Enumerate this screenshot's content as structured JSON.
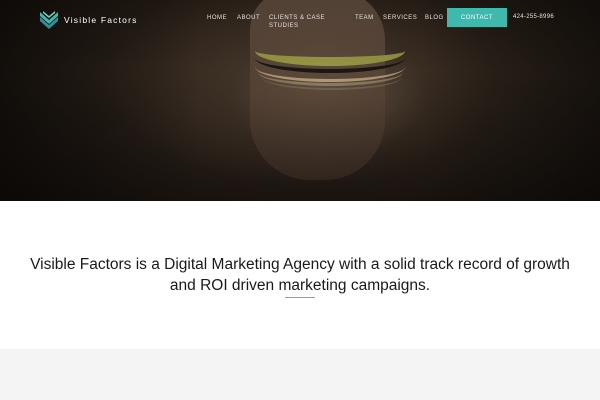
{
  "brand": {
    "name": "Visible Factors",
    "accent": "#3fb8ad"
  },
  "nav": {
    "items": [
      {
        "label": "Home"
      },
      {
        "label": "About"
      },
      {
        "label": "Clients & Case Studies"
      },
      {
        "label": "Team"
      },
      {
        "label": "Services"
      },
      {
        "label": "Blog"
      }
    ],
    "contact_label": "Contact",
    "phone": "424-255-8996"
  },
  "intro": {
    "text": "Visible Factors is a Digital Marketing Agency with a solid track record of growth and ROI driven marketing campaigns."
  }
}
